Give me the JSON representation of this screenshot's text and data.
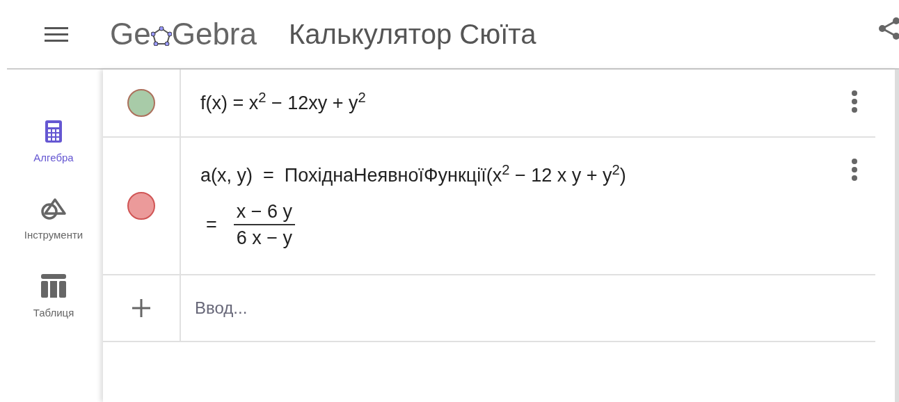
{
  "header": {
    "logo": {
      "before": "Ge",
      "after": "Gebra"
    },
    "title": "Калькулятор Сюїта"
  },
  "sidebar": {
    "items": [
      {
        "kind": "calculator",
        "label": "Алгебра",
        "selected": true
      },
      {
        "kind": "tools",
        "label": "Інструменти",
        "selected": false
      },
      {
        "kind": "table",
        "label": "Таблиця",
        "selected": false
      }
    ]
  },
  "algebra": {
    "rows": [
      {
        "color": "#a8cba8",
        "definition": "f(x) = x$^{2}$ − 12xy + y$^{2}$"
      },
      {
        "color": "#eb9a9a",
        "definition": "a(x, y)  =  ПохіднаНеявноїФункції(x$^{2}$ − 12 x y + y$^{2}$)",
        "result": {
          "equals": "=",
          "numerator": "x − 6 y",
          "denominator": "6 x − y"
        }
      }
    ],
    "input": {
      "placeholder": "Ввод..."
    }
  }
}
